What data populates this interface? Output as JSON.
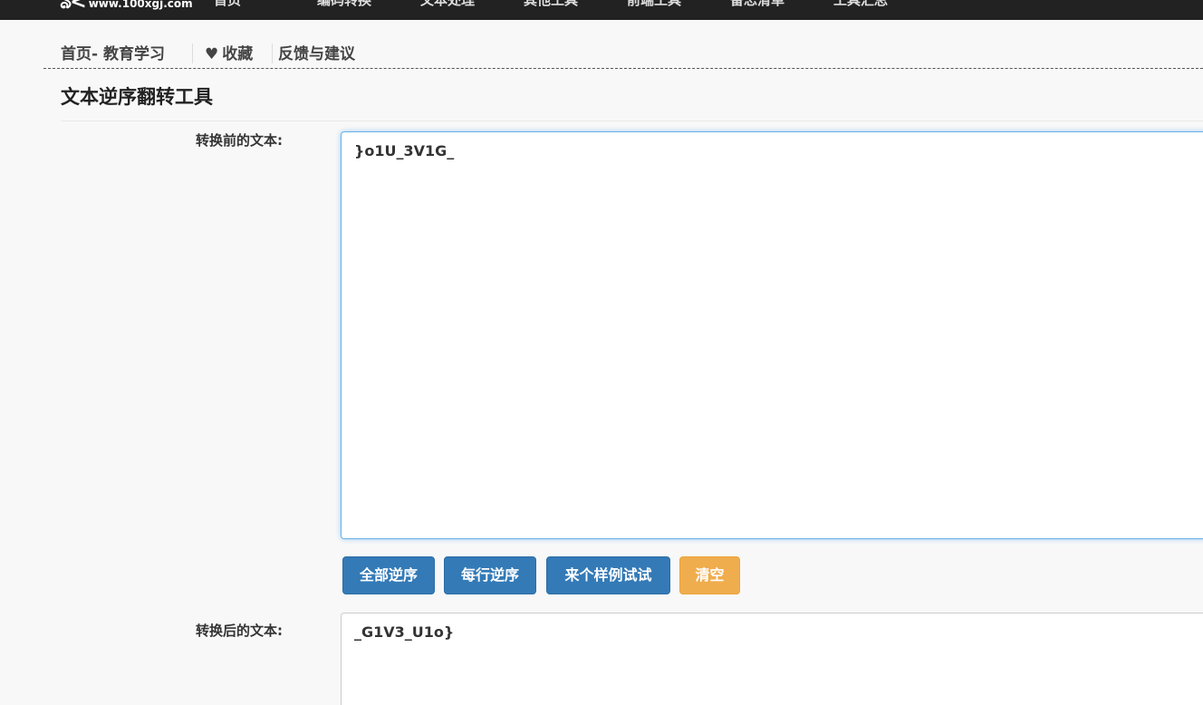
{
  "header": {
    "logo_mark": "ঌ<",
    "logo_url": "www.100xgj.com",
    "nav": [
      "首页",
      "编码转换",
      "文本处理",
      "其他工具",
      "前端工具",
      "备忘清单",
      "工具汇总"
    ]
  },
  "breadcrumb": {
    "home": "首页- 教育学习",
    "favorite": "收藏",
    "feedback": "反馈与建议"
  },
  "page_title": "文本逆序翻转工具",
  "form": {
    "input_label": "转换前的文本:",
    "input_value": "}o1U_3V1G_",
    "output_label": "转换后的文本:",
    "output_value": "_G1V3_U1o}",
    "buttons": {
      "reverse_all": "全部逆序",
      "reverse_each_line": "每行逆序",
      "try_sample": "来个样例试试",
      "clear": "清空"
    }
  },
  "colors": {
    "topbar": "#222222",
    "primary": "#337ab7",
    "warning": "#f0ad4e",
    "focus_border": "#66afe9"
  }
}
